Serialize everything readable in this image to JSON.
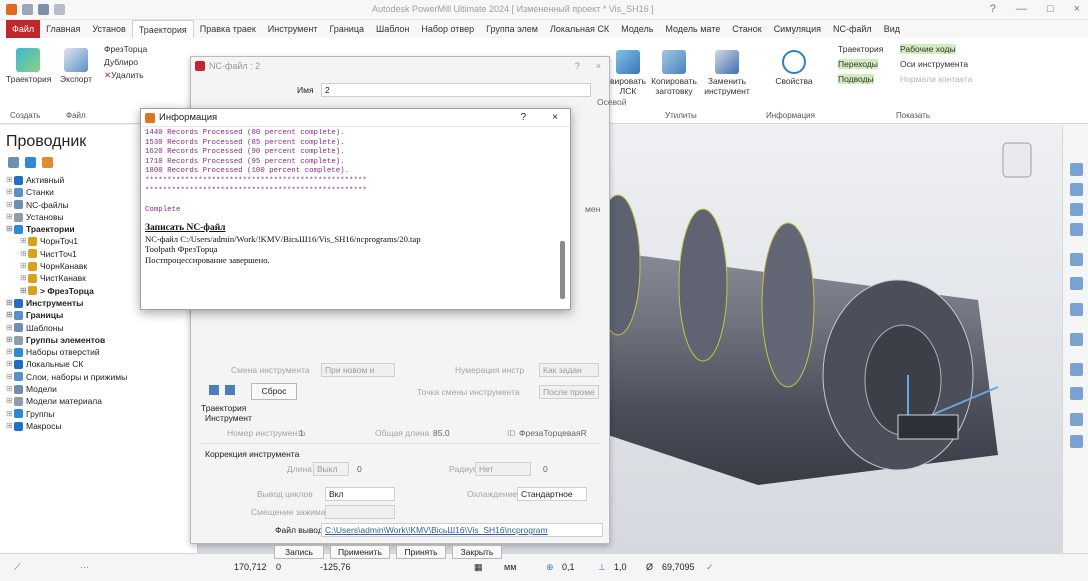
{
  "window": {
    "title": "Autodesk PowerMill Ultimate 2024   [ Измененный проект * Vis_SH16 ]",
    "controls": [
      "?",
      "—",
      "□",
      "×"
    ]
  },
  "tabs": [
    "Файл",
    "Главная",
    "Установ",
    "Траектория",
    "Правка траек",
    "Инструмент",
    "Граница",
    "Шаблон",
    "Набор отвер",
    "Группа элем",
    "Локальная СК",
    "Модель",
    "Модель мате",
    "Станок",
    "Симуляция",
    "NC-файл",
    "Вид"
  ],
  "ribbon": {
    "toolpath_btn": "Траектория",
    "export_btn": "Экспорт",
    "create_group": "Создать",
    "file_group": "Файл",
    "ftorc": "ФрезТорца",
    "duplicate": "Дублиро",
    "delete": "Удалить",
    "copy_left": "вировать",
    "copy_left2": "ЛСК",
    "copy_blank": "Копировать",
    "copy_blank2": "заготовку",
    "replace_tool": "Заменить",
    "replace_tool2": "инструмент",
    "utilities_group": "Утилиты",
    "properties": "Свойства",
    "info_group": "Информация",
    "show_toolpath": "Траектория",
    "show_feed": "Рабочие ходы",
    "show_rapid": "Переходы",
    "show_axis": "Оси инструмента",
    "show_leads": "Подводы",
    "show_normals": "Нормали контакта",
    "show_group": "Показать"
  },
  "explorer": {
    "title": "Проводник",
    "items": [
      {
        "label": "Активный",
        "bold": false,
        "indent": 0
      },
      {
        "label": "Станки",
        "bold": false,
        "indent": 0
      },
      {
        "label": "NC-файлы",
        "bold": false,
        "indent": 0
      },
      {
        "label": "Установы",
        "bold": false,
        "indent": 0
      },
      {
        "label": "Траектории",
        "bold": true,
        "indent": 0
      },
      {
        "label": "ЧорнТоч1",
        "bold": false,
        "indent": 1
      },
      {
        "label": "ЧистТоч1",
        "bold": false,
        "indent": 1
      },
      {
        "label": "ЧорнКанавк",
        "bold": false,
        "indent": 1
      },
      {
        "label": "ЧистКанавк",
        "bold": false,
        "indent": 1
      },
      {
        "label": "> ФрезТорца",
        "bold": true,
        "indent": 1
      },
      {
        "label": "Инструменты",
        "bold": true,
        "indent": 0
      },
      {
        "label": "Границы",
        "bold": true,
        "indent": 0
      },
      {
        "label": "Шаблоны",
        "bold": false,
        "indent": 0
      },
      {
        "label": "Группы элементов",
        "bold": true,
        "indent": 0
      },
      {
        "label": "Наборы отверстий",
        "bold": false,
        "indent": 0
      },
      {
        "label": "Локальные СК",
        "bold": false,
        "indent": 0
      },
      {
        "label": "Слои, наборы и прижимы",
        "bold": false,
        "indent": 0
      },
      {
        "label": "Модели",
        "bold": false,
        "indent": 0
      },
      {
        "label": "Модели материала",
        "bold": false,
        "indent": 0
      },
      {
        "label": "Группы",
        "bold": false,
        "indent": 0
      },
      {
        "label": "Макросы",
        "bold": false,
        "indent": 0
      }
    ]
  },
  "nc_dialog": {
    "title": "NC-файл : 2",
    "name_label": "Имя",
    "name_value": "2",
    "tool_change_label": "Смена инструмента",
    "tool_change_value": "При новом и",
    "tool_numbering_label": "Нумерация инстр",
    "tool_numbering_value": "Как задан",
    "reset_btn": "Сброс",
    "tool_change_point_label": "Точка смены инструмента",
    "tool_change_point_value": "После проме",
    "toolpath_header": "Траектория",
    "tool_header": "Инструмент",
    "tool_number_label": "Номер инструмента",
    "tool_number_value": "1",
    "total_length_label": "Общая длина",
    "total_length_value": "85.0",
    "tool_id_label": "ID",
    "tool_id_value": "ФрезаТорцеваяR",
    "tool_comp_header": "Коррекция инструмента",
    "length_label": "Длина",
    "length_mode": "Выкл",
    "length_value": "0",
    "radius_label": "Радиус",
    "radius_mode": "Нет",
    "radius_value": "0",
    "cycles_label": "Вывод циклов",
    "cycles_value": "Вкл",
    "cooling_label": "Охлаждение",
    "cooling_value": "Стандартное",
    "offset_clamp_label": "Смещение зажима",
    "output_file_label": "Файл вывода",
    "output_file_value": "C:\\Users\\admin\\Work\\!KMV\\ВісьШ16\\Vis_SH16\\ncprogram",
    "right_fields": [
      "Осевой",
      "мен"
    ],
    "buttons": {
      "write": "Запись",
      "apply": "Применить",
      "accept": "Принять",
      "close": "Закрыть"
    }
  },
  "info_dialog": {
    "title": "Информация",
    "help": "?",
    "close": "×",
    "log_lines": [
      "1440 Records Processed (80 percent complete).",
      "1530 Records Processed (85 percent complete).",
      "1620 Records Processed (90 percent complete).",
      "1710 Records Processed (95 percent complete).",
      "1800 Records Processed (100 percent complete).",
      "**************************************************",
      "**************************************************",
      "",
      "Complete"
    ],
    "write_header": "Записать NC-файл",
    "details": [
      "NC-файл C:/Users/admin/Work/!KMV/ВісьШ16/Vis_SH16/ncprograms/20.tap",
      "Toolpath ФрезТорца",
      "Постпроцессирование завершено."
    ]
  },
  "status": {
    "x": "170,712",
    "y": "0",
    "z": "-125,76",
    "units": "мм",
    "tolerance": "0,1",
    "step": "1,0",
    "diameter": "69,7095"
  }
}
